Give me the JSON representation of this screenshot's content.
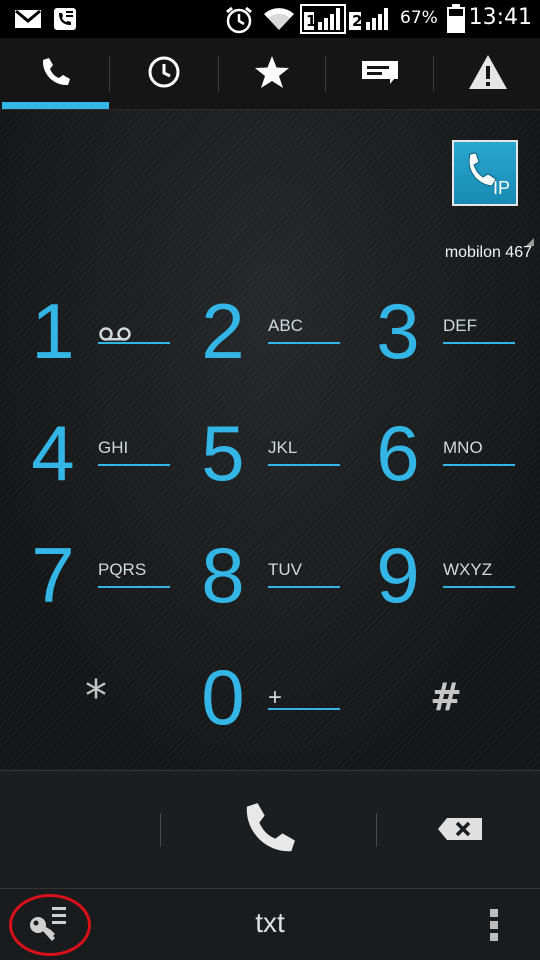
{
  "status_bar": {
    "sim1_label": "1",
    "sim2_label": "2",
    "battery": "67%",
    "time": "13:41",
    "icons": [
      "gmail-icon",
      "phone-msg-icon",
      "alarm-icon",
      "wifi-icon",
      "sim1-signal-icon",
      "sim2-signal-icon",
      "battery-icon"
    ]
  },
  "tabs": [
    {
      "name": "phone",
      "icon": "phone-icon",
      "selected": true
    },
    {
      "name": "call-log",
      "icon": "clock-icon",
      "selected": false
    },
    {
      "name": "favorites",
      "icon": "star-icon",
      "selected": false
    },
    {
      "name": "messages",
      "icon": "message-icon",
      "selected": false
    },
    {
      "name": "warning",
      "icon": "warning-icon",
      "selected": false
    }
  ],
  "ip_button": {
    "label": "IP",
    "icon": "ip-call-icon"
  },
  "account": {
    "label": "mobilon 467"
  },
  "keys": [
    {
      "digit": "1",
      "letters": "",
      "icon": "voicemail-icon"
    },
    {
      "digit": "2",
      "letters": "ABC"
    },
    {
      "digit": "3",
      "letters": "DEF"
    },
    {
      "digit": "4",
      "letters": "GHI"
    },
    {
      "digit": "5",
      "letters": "JKL"
    },
    {
      "digit": "6",
      "letters": "MNO"
    },
    {
      "digit": "7",
      "letters": "PQRS"
    },
    {
      "digit": "8",
      "letters": "TUV"
    },
    {
      "digit": "9",
      "letters": "WXYZ"
    },
    {
      "digit": "*",
      "letters": ""
    },
    {
      "digit": "0",
      "letters": "+"
    },
    {
      "digit": "#",
      "letters": ""
    }
  ],
  "actions": {
    "call_icon": "call-icon",
    "backspace_icon": "backspace-icon"
  },
  "bottom_bar": {
    "left_icon": "key-menu-icon",
    "center_label": "txt",
    "right_icon": "overflow-menu-icon"
  },
  "colors": {
    "accent": "#33b5e5",
    "highlight": "#d8101a"
  }
}
